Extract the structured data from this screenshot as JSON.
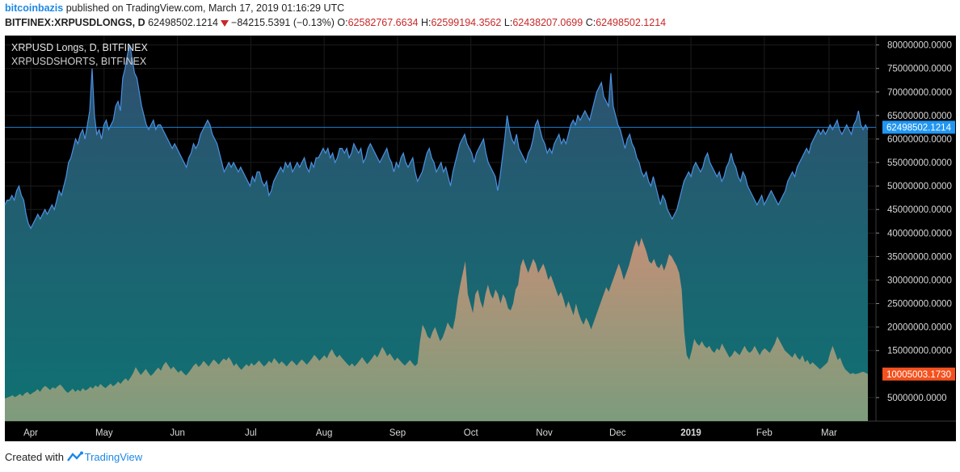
{
  "header": {
    "author": "bitcoinbazis",
    "published": "published on TradingView.com, March 17, 2019 01:16:29 UTC",
    "symbol": "BITFINEX:XRPUSDLONGS, D",
    "last": "62498502.1214",
    "change": "−84215.5391 (−0.13%)",
    "o_label": "O:",
    "o_value": "62582767.6634",
    "h_label": "H:",
    "h_value": "62599194.3562",
    "l_label": "L:",
    "l_value": "62438207.0699",
    "c_label": "C:",
    "c_value": "62498502.1214"
  },
  "legend": {
    "line1": "XRPUSD Longs, D, BITFINEX",
    "line2": "XRPUSDSHORTS, BITFINEX"
  },
  "footer": {
    "prefix": "Created with",
    "brand": "TradingView"
  },
  "colors": {
    "background": "#000000",
    "longs_line": "#4a90e2",
    "longs_fill_top": "#2f4f6f",
    "longs_fill_bottom": "#0e7272",
    "shorts_fill_top": "#c09077",
    "shorts_fill_bottom": "#7c9c7c",
    "longs_badge": "#2196f3",
    "shorts_badge": "#f4511e"
  },
  "chart_data": {
    "type": "area",
    "x_start": "2019-03-17",
    "ylim": [
      0,
      82000000
    ],
    "y_ticks": [
      "80000000.0000",
      "75000000.0000",
      "70000000.0000",
      "65000000.0000",
      "60000000.0000",
      "55000000.0000",
      "50000000.0000",
      "45000000.0000",
      "40000000.0000",
      "35000000.0000",
      "30000000.0000",
      "25000000.0000",
      "20000000.0000",
      "15000000.0000",
      "5000000.0000"
    ],
    "y_tick_values": [
      80000000,
      75000000,
      70000000,
      65000000,
      60000000,
      55000000,
      50000000,
      45000000,
      40000000,
      35000000,
      30000000,
      25000000,
      20000000,
      15000000,
      5000000
    ],
    "x_ticks": [
      "Apr",
      "May",
      "Jun",
      "Jul",
      "Aug",
      "Sep",
      "Oct",
      "Nov",
      "Dec",
      "2019",
      "Feb",
      "Mar"
    ],
    "x_tick_positions": [
      0.03,
      0.115,
      0.2,
      0.285,
      0.37,
      0.455,
      0.54,
      0.625,
      0.71,
      0.795,
      0.88,
      0.955
    ],
    "longs_last_label": "62498502.1214",
    "longs_last_value": 62498502,
    "shorts_last_label": "10005003.1730",
    "shorts_last_value": 10005003,
    "series": [
      {
        "name": "XRPUSD Longs",
        "values": [
          46,
          47,
          47,
          48,
          47,
          49,
          50,
          48,
          47,
          44,
          42,
          41,
          42,
          43,
          44,
          43,
          44,
          45,
          44,
          45,
          46,
          45,
          47,
          49,
          48,
          50,
          52,
          55,
          56,
          58,
          60,
          59,
          61,
          62,
          60,
          63,
          66,
          75,
          65,
          61,
          62,
          60,
          63,
          64,
          62,
          63,
          64,
          67,
          68,
          66,
          73,
          75,
          78,
          80,
          77,
          74,
          73,
          70,
          67,
          65,
          63,
          62,
          63,
          64,
          62,
          63,
          63,
          62,
          61,
          60,
          59,
          58,
          59,
          58,
          57,
          56,
          55,
          54,
          56,
          57,
          59,
          58,
          59,
          61,
          62,
          63,
          64,
          63,
          61,
          60,
          59,
          57,
          55,
          53,
          54,
          55,
          54,
          55,
          54,
          53,
          54,
          53,
          52,
          51,
          50,
          52,
          51,
          53,
          53,
          51,
          50,
          51,
          48,
          49,
          51,
          52,
          53,
          54,
          53,
          55,
          54,
          55,
          53,
          54,
          55,
          54,
          55,
          56,
          54,
          53,
          55,
          54,
          56,
          56,
          57,
          58,
          57,
          58,
          56,
          57,
          55,
          56,
          58,
          58,
          57,
          58,
          56,
          57,
          59,
          58,
          57,
          58,
          55,
          56,
          58,
          59,
          58,
          57,
          56,
          55,
          56,
          57,
          58,
          56,
          55,
          53,
          55,
          54,
          56,
          57,
          55,
          54,
          55,
          56,
          53,
          51,
          52,
          53,
          55,
          57,
          58,
          56,
          55,
          53,
          54,
          55,
          53,
          54,
          52,
          50,
          53,
          55,
          57,
          59,
          60,
          61,
          59,
          58,
          57,
          55,
          57,
          58,
          59,
          60,
          57,
          55,
          54,
          53,
          52,
          49,
          52,
          56,
          60,
          65,
          62,
          60,
          59,
          61,
          58,
          57,
          56,
          55,
          57,
          58,
          60,
          63,
          64,
          62,
          60,
          59,
          57,
          58,
          57,
          59,
          60,
          61,
          59,
          60,
          59,
          61,
          63,
          64,
          63,
          65,
          64,
          65,
          66,
          65,
          64,
          66,
          68,
          70,
          71,
          72,
          69,
          68,
          67,
          74,
          67,
          65,
          63,
          62,
          60,
          58,
          60,
          61,
          59,
          58,
          56,
          55,
          53,
          52,
          53,
          51,
          50,
          52,
          50,
          48,
          46,
          48,
          47,
          45,
          44,
          43,
          44,
          45,
          47,
          49,
          51,
          52,
          53,
          52,
          54,
          55,
          54,
          53,
          54,
          56,
          57,
          55,
          54,
          53,
          52,
          53,
          51,
          52,
          54,
          55,
          57,
          55,
          54,
          52,
          51,
          53,
          52,
          50,
          49,
          48,
          47,
          46,
          47,
          48,
          46,
          47,
          48,
          49,
          48,
          47,
          46,
          47,
          48,
          49,
          51,
          52,
          53,
          52,
          54,
          55,
          56,
          57,
          58,
          57,
          59,
          60,
          61,
          62,
          61,
          62,
          61,
          62,
          63,
          62,
          63,
          64,
          62,
          61,
          62,
          63,
          62,
          61,
          63,
          64,
          66,
          63,
          62,
          63,
          62
        ]
      },
      {
        "name": "XRPUSDSHORTS",
        "values": [
          4.8,
          5.0,
          5.2,
          5.5,
          5.1,
          5.4,
          5.8,
          5.3,
          5.9,
          6.2,
          5.6,
          6.0,
          6.3,
          6.8,
          6.2,
          7.0,
          7.5,
          7.1,
          6.6,
          7.2,
          6.9,
          7.4,
          7.8,
          7.2,
          6.5,
          6.0,
          6.4,
          6.9,
          6.2,
          6.7,
          6.3,
          7.0,
          6.5,
          6.8,
          7.3,
          6.9,
          7.6,
          7.2,
          7.9,
          7.4,
          7.0,
          7.5,
          8.0,
          7.4,
          7.8,
          8.4,
          7.9,
          8.6,
          9.1,
          8.5,
          9.3,
          10.2,
          11.5,
          10.6,
          9.8,
          10.4,
          11.1,
          10.3,
          9.6,
          10.1,
          10.8,
          11.4,
          10.7,
          11.9,
          12.6,
          11.8,
          11.0,
          11.6,
          10.9,
          10.3,
          10.8,
          10.2,
          9.7,
          10.3,
          11.0,
          11.8,
          12.3,
          11.5,
          12.0,
          12.8,
          12.2,
          11.6,
          12.4,
          13.1,
          12.6,
          12.0,
          12.7,
          13.3,
          12.9,
          13.6,
          12.8,
          11.7,
          12.3,
          11.5,
          10.9,
          11.5,
          12.1,
          11.6,
          12.4,
          11.8,
          12.3,
          12.9,
          12.2,
          11.6,
          12.1,
          12.8,
          12.3,
          13.4,
          12.8,
          12.1,
          12.7,
          12.2,
          11.6,
          12.3,
          12.9,
          12.4,
          11.8,
          12.5,
          13.1,
          12.6,
          12.0,
          12.6,
          13.3,
          14.1,
          13.5,
          12.8,
          13.4,
          14.0,
          13.3,
          14.5,
          15.3,
          14.2,
          13.5,
          14.1,
          13.4,
          12.8,
          12.2,
          11.7,
          12.3,
          11.6,
          12.2,
          12.9,
          13.6,
          12.8,
          12.1,
          12.7,
          13.4,
          14.2,
          13.5,
          14.6,
          15.8,
          14.9,
          13.8,
          14.4,
          13.6,
          12.8,
          13.5,
          12.9,
          12.3,
          11.8,
          12.4,
          13.0,
          12.3,
          11.7,
          12.2,
          17.0,
          20.5,
          19.5,
          18.0,
          17.5,
          19.0,
          20.0,
          18.5,
          17.0,
          17.8,
          19.3,
          21.0,
          20.0,
          19.5,
          22.0,
          26.0,
          29.0,
          31.5,
          34.0,
          27.0,
          25.0,
          23.0,
          27.0,
          28.0,
          25.5,
          24.0,
          27.0,
          29.0,
          27.0,
          26.0,
          28.0,
          27.0,
          25.0,
          27.0,
          26.0,
          24.0,
          23.5,
          25.0,
          28.0,
          29.0,
          33.0,
          34.5,
          33.0,
          31.5,
          33.0,
          34.5,
          33.5,
          31.5,
          32.5,
          33.5,
          32.0,
          30.0,
          31.0,
          29.5,
          28.0,
          26.5,
          27.5,
          26.0,
          24.0,
          25.5,
          24.0,
          22.5,
          25.0,
          23.0,
          21.5,
          20.5,
          22.0,
          21.0,
          19.5,
          21.0,
          22.5,
          24.0,
          25.5,
          27.0,
          28.5,
          27.5,
          29.0,
          30.5,
          32.0,
          33.5,
          32.0,
          30.0,
          31.5,
          33.0,
          35.0,
          37.0,
          38.5,
          37.0,
          39.0,
          37.5,
          36.0,
          34.0,
          33.5,
          34.5,
          33.0,
          32.5,
          33.5,
          32.0,
          33.5,
          35.5,
          35.0,
          34.0,
          33.0,
          31.5,
          28.0,
          19.0,
          14.0,
          13.0,
          15.0,
          17.5,
          16.5,
          16.0,
          17.0,
          16.0,
          15.5,
          16.0,
          15.0,
          14.5,
          15.5,
          15.0,
          16.5,
          15.5,
          14.5,
          13.5,
          14.0,
          15.0,
          14.5,
          14.0,
          15.0,
          16.0,
          15.0,
          14.5,
          15.0,
          16.0,
          15.0,
          14.0,
          15.0,
          15.5,
          15.0,
          14.5,
          15.5,
          16.5,
          18.0,
          17.0,
          16.0,
          15.0,
          14.5,
          14.0,
          13.5,
          14.5,
          13.5,
          13.0,
          14.0,
          12.5,
          13.0,
          12.0,
          12.5,
          12.0,
          11.5,
          11.0,
          11.5,
          12.0,
          12.5,
          14.5,
          16.0,
          14.5,
          13.0,
          13.5,
          12.0,
          11.0,
          10.5,
          10.0,
          10.2,
          10.0,
          10.1,
          10.3,
          10.5,
          10.3,
          10.0
        ]
      }
    ]
  }
}
